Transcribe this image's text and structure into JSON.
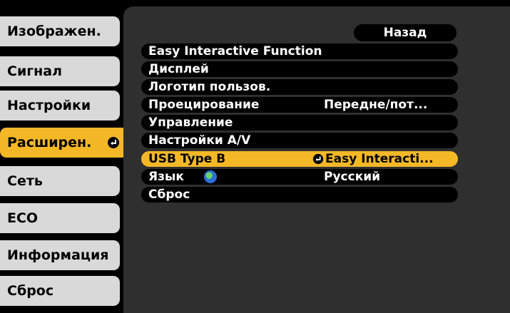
{
  "tabs": [
    {
      "label": "Изображен.",
      "active": false
    },
    {
      "label": "Сигнал",
      "active": false
    },
    {
      "label": "Настройки",
      "active": false
    },
    {
      "label": "Расширен.",
      "active": true
    },
    {
      "label": "Сеть",
      "active": false
    },
    {
      "label": "ECO",
      "active": false
    },
    {
      "label": "Информация",
      "active": false
    },
    {
      "label": "Сброс",
      "active": false
    }
  ],
  "back_label": "Назад",
  "menu": [
    {
      "label": "Easy Interactive Function",
      "value": ""
    },
    {
      "label": "Дисплей",
      "value": ""
    },
    {
      "label": "Логотип пользов.",
      "value": ""
    },
    {
      "label": "Проецирование",
      "value": "Передне/пот..."
    },
    {
      "label": "Управление",
      "value": ""
    },
    {
      "label": "Настройки A/V",
      "value": ""
    },
    {
      "label": "USB Type B",
      "value": "Easy Interacti..."
    },
    {
      "label": "Язык",
      "value": "Русский"
    },
    {
      "label": "Сброс",
      "value": ""
    }
  ],
  "colors": {
    "accent": "#f4b827",
    "tab": "#d9d9d9",
    "panel": "#2f2f2f"
  }
}
